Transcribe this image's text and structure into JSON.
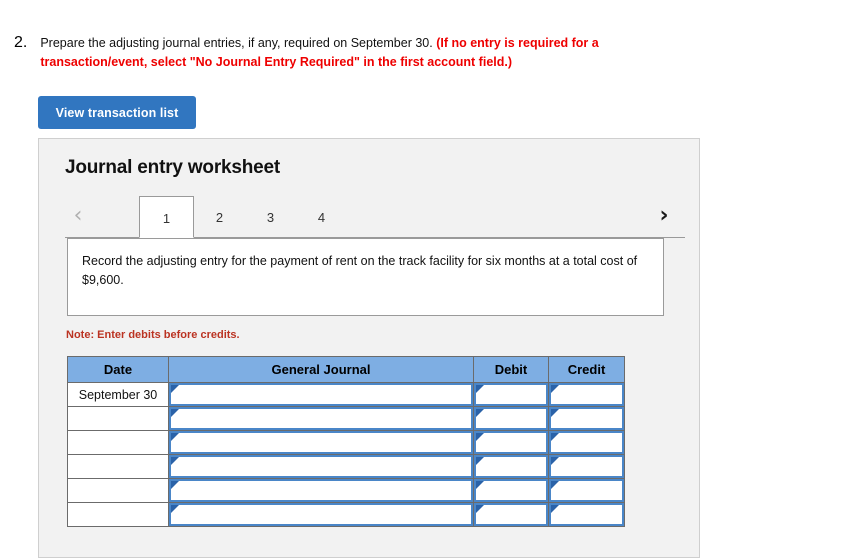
{
  "question": {
    "number": "2.",
    "main_text": "Prepare the adjusting journal entries, if any, required on September 30. ",
    "emphasis_text": "(If no entry is required for a transaction/event, select \"No Journal Entry Required\" in the first account field.)"
  },
  "toolbar": {
    "view_transaction_list_label": "View transaction list"
  },
  "worksheet": {
    "title": "Journal entry worksheet",
    "prev_icon": "chevron-left-icon",
    "next_icon": "chevron-right-icon",
    "prev_glyph": "‹",
    "next_glyph": "›",
    "tabs": [
      {
        "label": "1",
        "active": true
      },
      {
        "label": "2",
        "active": false
      },
      {
        "label": "3",
        "active": false
      },
      {
        "label": "4",
        "active": false
      }
    ],
    "description": "Record the adjusting entry for the payment of rent on the track facility for six months at a total cost of $9,600.",
    "note": "Note: Enter debits before credits."
  },
  "table": {
    "columns": [
      "Date",
      "General Journal",
      "Debit",
      "Credit"
    ],
    "rows": [
      {
        "date": "September 30",
        "general_journal": "",
        "debit": "",
        "credit": ""
      },
      {
        "date": "",
        "general_journal": "",
        "debit": "",
        "credit": ""
      },
      {
        "date": "",
        "general_journal": "",
        "debit": "",
        "credit": ""
      },
      {
        "date": "",
        "general_journal": "",
        "debit": "",
        "credit": ""
      },
      {
        "date": "",
        "general_journal": "",
        "debit": "",
        "credit": ""
      },
      {
        "date": "",
        "general_journal": "",
        "debit": "",
        "credit": ""
      }
    ]
  },
  "colors": {
    "button_blue": "#3176c0",
    "header_blue": "#7eaee3",
    "input_border_blue": "#4a86c8",
    "alert_red": "#ee0000",
    "note_red": "#bb3322",
    "panel_gray": "#f2f2f2"
  }
}
